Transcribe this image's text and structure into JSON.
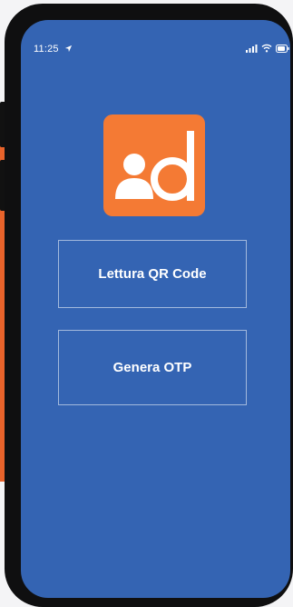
{
  "status_bar": {
    "time": "11:25",
    "location_icon": "location-arrow-icon",
    "signal_icon": "cellular-signal-icon",
    "wifi_icon": "wifi-icon",
    "battery_icon": "battery-icon"
  },
  "app": {
    "logo_icon": "app-logo-icon",
    "logo_letter": "d"
  },
  "buttons": {
    "qr_label": "Lettura QR Code",
    "otp_label": "Genera OTP"
  },
  "colors": {
    "background": "#3464b3",
    "logo": "#f47a34",
    "accent_backdrop": "#e8632b",
    "text": "#ffffff"
  }
}
